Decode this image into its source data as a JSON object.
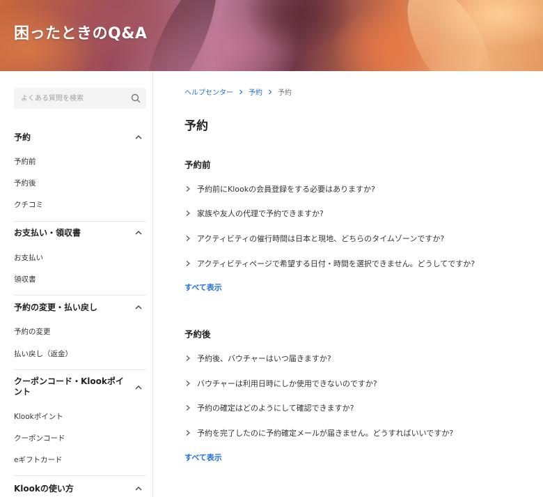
{
  "header": {
    "title": "困ったときのQ&A"
  },
  "search": {
    "placeholder": "よくある質問を検索"
  },
  "sidebar": {
    "sections": [
      {
        "title": "予約",
        "items": [
          "予約前",
          "予約後",
          "クチコミ"
        ]
      },
      {
        "title": "お支払い・領収書",
        "items": [
          "お支払い",
          "領収書"
        ]
      },
      {
        "title": "予約の変更・払い戻し",
        "items": [
          "予約の変更",
          "払い戻し（返金）"
        ]
      },
      {
        "title": "クーポンコード・Klookポイント",
        "items": [
          "Klookポイント",
          "クーポンコード",
          "eギフトカード"
        ]
      },
      {
        "title": "Klookの使い方",
        "items": []
      }
    ]
  },
  "breadcrumb": [
    "ヘルプセンター",
    "予約",
    "予約"
  ],
  "main": {
    "title": "予約",
    "groups": [
      {
        "title": "予約前",
        "questions": [
          "予約前にKlookの会員登録をする必要はありますか?",
          "家族や友人の代理で予約できますか?",
          "アクティビティの催行時間は日本と現地、どちらのタイムゾーンですか?",
          "アクティビティページで希望する日付・時間を選択できません。どうしてですか?"
        ],
        "show_all": "すべて表示"
      },
      {
        "title": "予約後",
        "questions": [
          "予約後、バウチャーはいつ届きますか?",
          "バウチャーは利用日時にしか使用できないのですか?",
          "予約の確定はどのようにして確認できますか?",
          "予約を完了したのに予約確定メールが届きません。どうすればいいですか?"
        ],
        "show_all": "すべて表示"
      }
    ]
  },
  "colors": {
    "link": "#1e6fd9",
    "text": "#212121",
    "muted": "#757575"
  }
}
